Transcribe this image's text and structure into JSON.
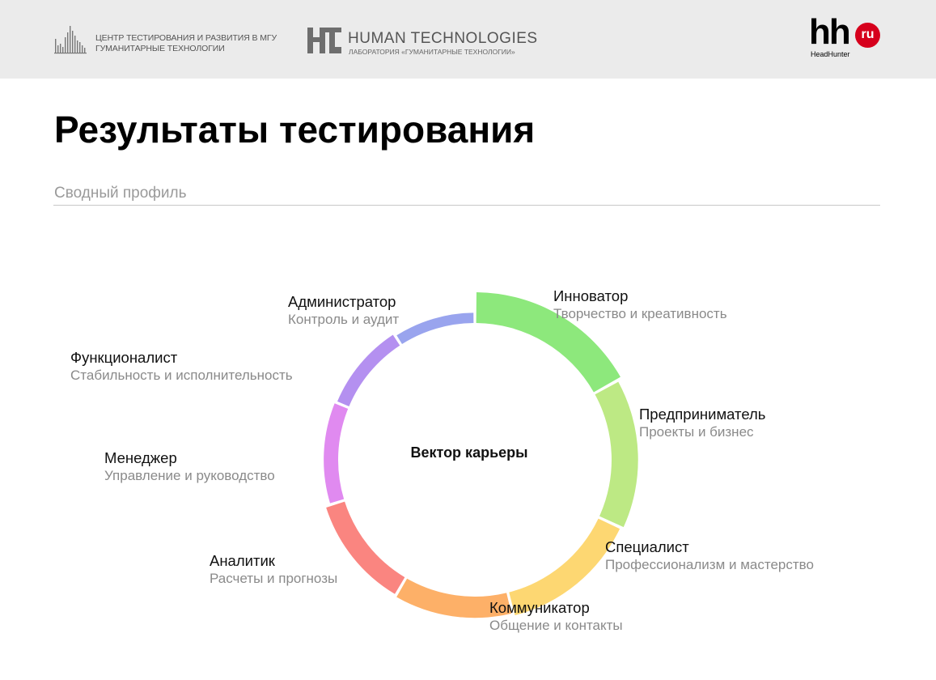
{
  "header": {
    "logo1_line1": "ЦЕНТР ТЕСТИРОВАНИЯ И РАЗВИТИЯ В МГУ",
    "logo1_line2": "ГУМАНИТАРНЫЕ ТЕХНОЛОГИИ",
    "logo2_title": "HUMAN TECHNOLOGIES",
    "logo2_sub": "ЛАБОРАТОРИЯ «ГУМАНИТАРНЫЕ ТЕХНОЛОГИИ»",
    "hh_letters": "hh",
    "hh_badge": "ru",
    "hh_sub": "HeadHunter"
  },
  "page": {
    "title": "Результаты тестирования",
    "subtitle": "Сводный профиль"
  },
  "chart_data": {
    "type": "pie",
    "center_label": "Вектор карьеры",
    "start_angle_deg": 0,
    "segments": [
      {
        "name": "Инноватор",
        "description": "Творчество и креативность",
        "color": "#8de87c",
        "value": 17.5,
        "thickness": 1.0
      },
      {
        "name": "Предприниматель",
        "description": "Проекты и бизнес",
        "color": "#bde984",
        "value": 15.5,
        "thickness": 0.83
      },
      {
        "name": "Специалист",
        "description": "Профессионализм и мастерство",
        "color": "#fdd772",
        "value": 14.7,
        "thickness": 0.72
      },
      {
        "name": "Коммуникатор",
        "description": "Общение и контакты",
        "color": "#fdb068",
        "value": 12.7,
        "thickness": 0.62
      },
      {
        "name": "Аналитик",
        "description": "Расчеты и прогнозы",
        "color": "#fa8580",
        "value": 12.2,
        "thickness": 0.55
      },
      {
        "name": "Менеджер",
        "description": "Управление и руководство",
        "color": "#e08af0",
        "value": 11.4,
        "thickness": 0.35
      },
      {
        "name": "Функционалист",
        "description": "Стабильность и исполнительность",
        "color": "#b490f0",
        "value": 10.0,
        "thickness": 0.28
      },
      {
        "name": "Администратор",
        "description": "Контроль и аудит",
        "color": "#99a4ee",
        "value": 9.4,
        "thickness": 0.18
      }
    ]
  }
}
